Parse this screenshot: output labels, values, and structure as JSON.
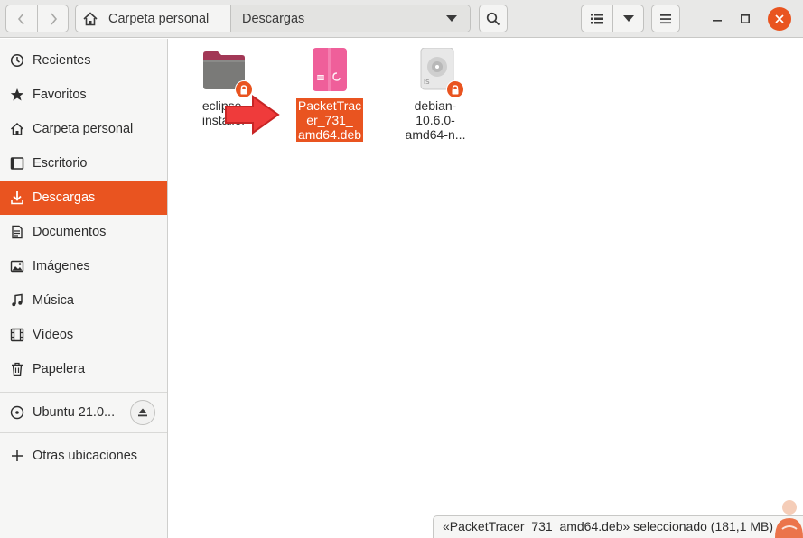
{
  "header": {
    "path": {
      "home_label": "Carpeta personal",
      "current_label": "Descargas"
    }
  },
  "sidebar": {
    "items": [
      {
        "label": "Recientes",
        "icon": "clock-icon"
      },
      {
        "label": "Favoritos",
        "icon": "star-icon"
      },
      {
        "label": "Carpeta personal",
        "icon": "home-icon"
      },
      {
        "label": "Escritorio",
        "icon": "desktop-icon"
      },
      {
        "label": "Descargas",
        "icon": "download-icon",
        "active": true
      },
      {
        "label": "Documentos",
        "icon": "document-icon"
      },
      {
        "label": "Imágenes",
        "icon": "image-icon"
      },
      {
        "label": "Música",
        "icon": "music-icon"
      },
      {
        "label": "Vídeos",
        "icon": "video-icon"
      },
      {
        "label": "Papelera",
        "icon": "trash-icon"
      }
    ],
    "volume": {
      "label": "Ubuntu 21.0...",
      "icon": "disc-icon"
    },
    "other": {
      "label": "Otras ubicaciones",
      "icon": "plus-icon"
    }
  },
  "files": [
    {
      "name_lines": [
        "eclipse-",
        "installer"
      ],
      "icon": "folder-icon",
      "locked": true
    },
    {
      "name_lines": [
        "PacketTrac",
        "er_731_",
        "amd64.deb"
      ],
      "icon": "deb-package-icon",
      "selected": true
    },
    {
      "name_lines": [
        "debian-",
        "10.6.0-",
        "amd64-n..."
      ],
      "icon": "iso-disc-icon",
      "locked": true
    }
  ],
  "statusbar": {
    "text": "«PacketTracer_731_amd64.deb» seleccionado  (181,1 MB)"
  },
  "colors": {
    "accent": "#e95420",
    "headerbar": "#e8e8e7",
    "sidebar": "#f6f6f5",
    "deb_icon": "#ef5f9a"
  }
}
